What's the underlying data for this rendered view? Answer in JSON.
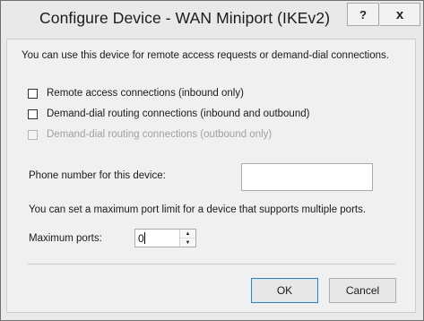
{
  "window": {
    "title": "Configure Device - WAN Miniport (IKEv2)",
    "help_label": "?",
    "close_label": "x"
  },
  "intro_text": "You can use this device for remote access requests or demand-dial connections.",
  "checkboxes": [
    {
      "label": "Remote access connections (inbound only)",
      "checked": false,
      "enabled": true
    },
    {
      "label": "Demand-dial routing connections (inbound and outbound)",
      "checked": false,
      "enabled": true
    },
    {
      "label": "Demand-dial routing connections (outbound only)",
      "checked": false,
      "enabled": false
    }
  ],
  "phone": {
    "label": "Phone number for this device:",
    "value": ""
  },
  "port_info": "You can set a maximum port limit for a device that supports multiple ports.",
  "max_ports": {
    "label": "Maximum ports:",
    "value": "0"
  },
  "buttons": {
    "ok": "OK",
    "cancel": "Cancel"
  }
}
